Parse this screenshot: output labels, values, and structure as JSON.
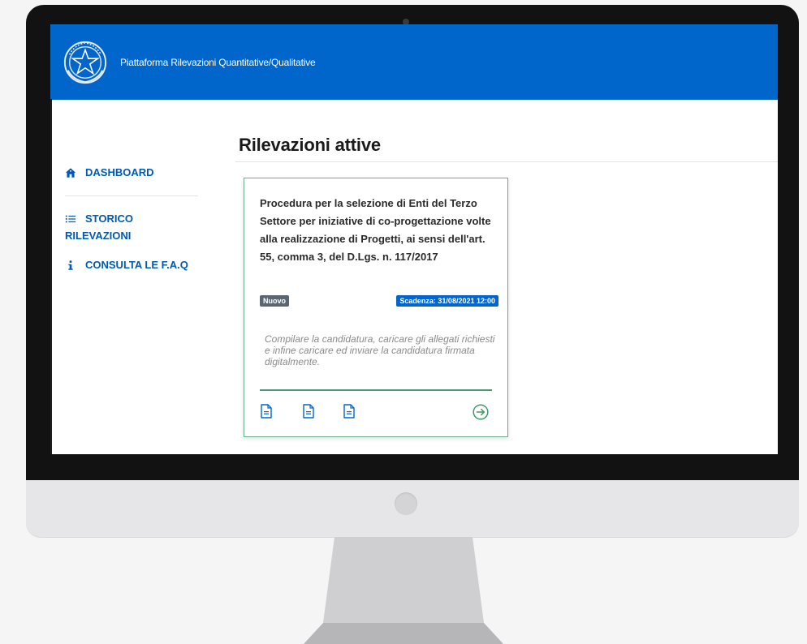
{
  "header": {
    "app_title": "Piattaforma Rilevazioni Quantitative/Qualitative",
    "emblem_icon": "repubblica-emblem-icon"
  },
  "sidebar": {
    "items": [
      {
        "label": "DASHBOARD",
        "icon": "home-icon"
      },
      {
        "label_line1": "STORICO",
        "label_line2": "RILEVAZIONI",
        "icon": "list-icon"
      },
      {
        "label": "CONSULTA LE F.A.Q",
        "icon": "info-icon"
      }
    ]
  },
  "main": {
    "title": "Rilevazioni attive",
    "card": {
      "title": "Procedura per la selezione di Enti del Terzo Settore per iniziative di co-progettazione volte alla realizzazione di Progetti, ai sensi dell'art. 55, comma 3, del D.Lgs. n. 117/2017",
      "badge_status": "Nuovo",
      "badge_deadline": "Scadenza: 31/08/2021 12:00",
      "description": "Compilare la candidatura, caricare gli allegati richiesti e infine caricare ed inviare la candidatura firmata digitalmente.",
      "actions": [
        "document-icon",
        "document-icon",
        "document-icon",
        "arrow-right-circle-icon"
      ]
    }
  },
  "colors": {
    "header_blue": "#0066cc",
    "nav_blue": "#0059b3",
    "card_border": "#68b08c",
    "card_rule": "#4a9a74",
    "badge_gray": "#5a6772"
  }
}
